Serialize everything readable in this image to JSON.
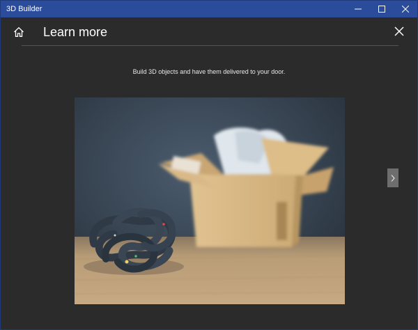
{
  "window": {
    "title": "3D Builder",
    "titlebar_color": "#2b4c9b",
    "controls": [
      "minimize-icon",
      "maximize-icon",
      "close-icon"
    ]
  },
  "header": {
    "home_icon": "home-icon",
    "title": "Learn more",
    "close_icon": "close-icon"
  },
  "content": {
    "subtitle": "Build 3D objects and have them delivered to your door.",
    "image_description_icon": "photo",
    "next_icon": "chevron-right-icon"
  },
  "colors": {
    "background": "#2b2b2b",
    "accent": "#2b4c9b",
    "next_button": "#6e6e6e"
  }
}
